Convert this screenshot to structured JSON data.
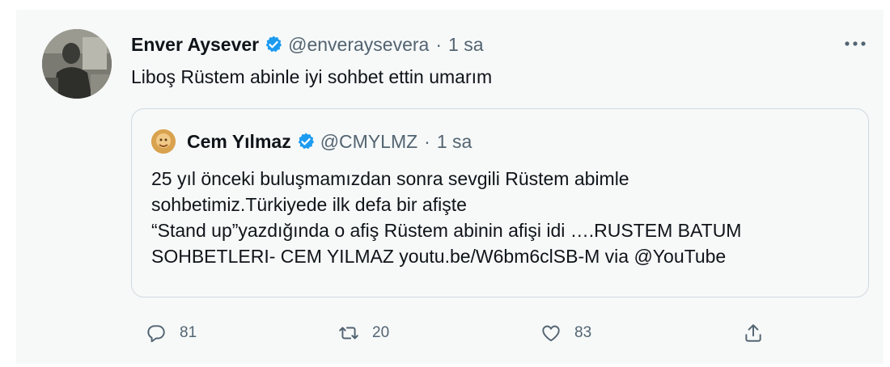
{
  "tweet": {
    "author_name": "Enver Aysever",
    "handle": "@enveraysevera",
    "separator": "·",
    "time": "1 sa",
    "text": "Liboş Rüstem abinle iyi sohbet ettin umarım"
  },
  "quote": {
    "author_name": "Cem Yılmaz",
    "handle": "@CMYLMZ",
    "separator": "·",
    "time": "1 sa",
    "lines": [
      "25 yıl önceki buluşmamızdan sonra sevgili Rüstem abimle",
      "sohbetimiz.Türkiyede ilk defa bir afişte",
      "“Stand up”yazdığında o afiş Rüstem abinin afişi idi ….RUSTEM BATUM",
      "SOHBETLERI- CEM YILMAZ youtu.be/W6bm6clSB-M via @YouTube"
    ]
  },
  "actions": {
    "reply_count": "81",
    "retweet_count": "20",
    "like_count": "83"
  },
  "icons": {
    "verified": "verified-badge-icon",
    "more": "more-dots-icon",
    "reply": "reply-icon",
    "retweet": "retweet-icon",
    "like": "heart-icon",
    "share": "share-icon"
  },
  "colors": {
    "accent": "#1d9bf0",
    "text": "#0f1419",
    "muted": "#536471",
    "background": "#f7f9f9",
    "border": "#cfd9de"
  }
}
